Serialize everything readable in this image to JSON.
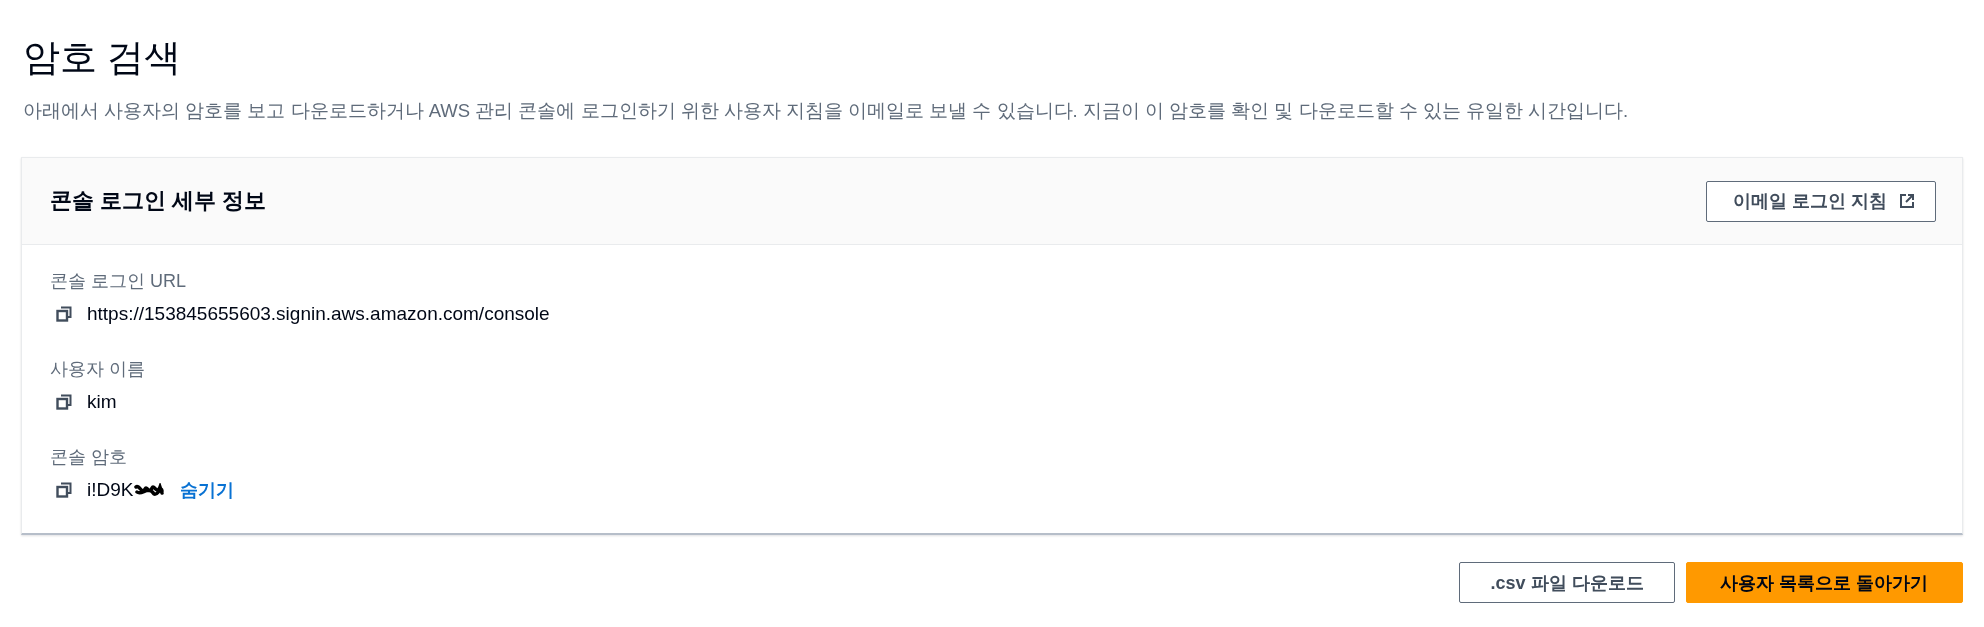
{
  "page": {
    "title": "암호 검색",
    "description": "아래에서 사용자의 암호를 보고 다운로드하거나 AWS 관리 콘솔에 로그인하기 위한 사용자 지침을 이메일로 보낼 수 있습니다. 지금이 이 암호를 확인 및 다운로드할 수 있는 유일한 시간입니다."
  },
  "card": {
    "title": "콘솔 로그인 세부 정보",
    "header_button": {
      "label": "이메일 로그인 지침"
    },
    "fields": [
      {
        "label": "콘솔 로그인 URL",
        "value": "https://153845655603.signin.aws.amazon.com/console"
      },
      {
        "label": "사용자 이름",
        "value": "kim"
      },
      {
        "label": "콘솔 암호",
        "value": "i!D9K",
        "redacted": true,
        "toggle": "숨기기"
      }
    ]
  },
  "actions": [
    {
      "label": ".csv 파일 다운로드",
      "kind": "secondary"
    },
    {
      "label": "사용자 목록으로 돌아가기",
      "kind": "primary"
    }
  ]
}
